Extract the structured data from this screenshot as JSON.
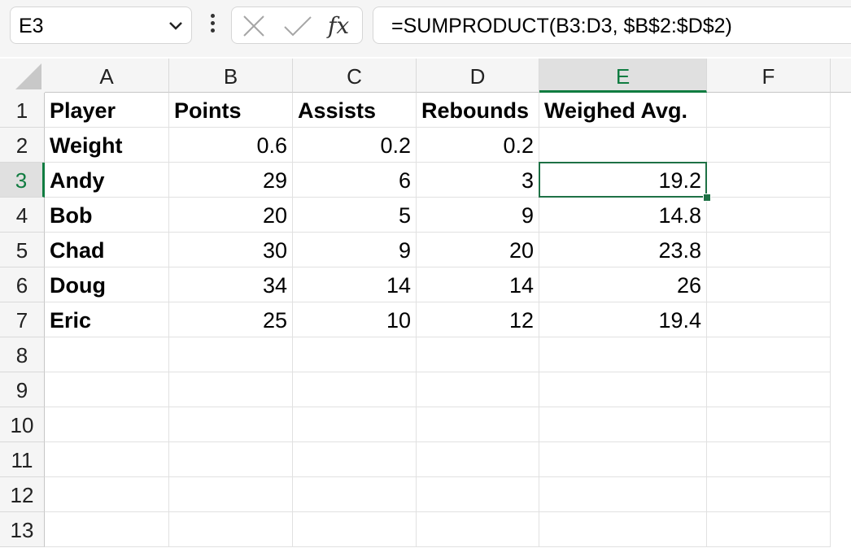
{
  "formula_bar": {
    "name_box": "E3",
    "fx_label": "fx",
    "formula": "=SUMPRODUCT(B3:D3, $B$2:$D$2)"
  },
  "columns": [
    "A",
    "B",
    "C",
    "D",
    "E",
    "F"
  ],
  "rows": [
    "1",
    "2",
    "3",
    "4",
    "5",
    "6",
    "7",
    "8",
    "9",
    "10",
    "11",
    "12",
    "13"
  ],
  "selected": {
    "column": "E",
    "row": "3"
  },
  "table": {
    "headers": [
      "Player",
      "Points",
      "Assists",
      "Rebounds",
      "Weighed Avg."
    ],
    "weight_row": [
      "Weight",
      "0.6",
      "0.2",
      "0.2",
      ""
    ],
    "data": [
      [
        "Andy",
        "29",
        "6",
        "3",
        "19.2"
      ],
      [
        "Bob",
        "20",
        "5",
        "9",
        "14.8"
      ],
      [
        "Chad",
        "30",
        "9",
        "20",
        "23.8"
      ],
      [
        "Doug",
        "34",
        "14",
        "14",
        "26"
      ],
      [
        "Eric",
        "25",
        "10",
        "12",
        "19.4"
      ]
    ]
  },
  "icons": [
    "chevron-down-icon",
    "more-vertical-icon",
    "cancel-x-icon",
    "enter-check-icon"
  ],
  "colors": {
    "accent": "#107c41",
    "selection_border": "#1e7145",
    "header_bg": "#f5f5f5"
  }
}
